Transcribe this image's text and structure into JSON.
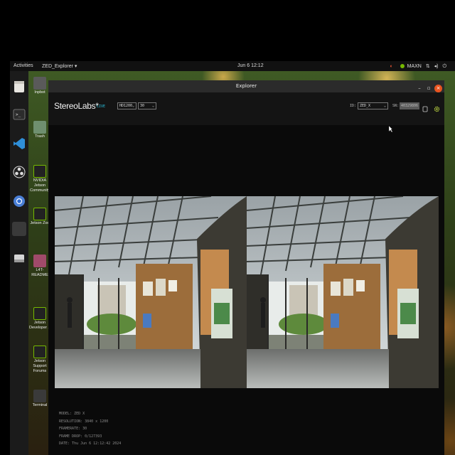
{
  "topbar": {
    "activities": "Activities",
    "app_menu": "ZED_Explorer ▾",
    "clock": "Jun 6 12:12",
    "power_mode": "MAXN",
    "tray_icons": [
      "nvidia-icon",
      "network-icon",
      "volume-icon",
      "power-icon"
    ]
  },
  "dock": {
    "items": [
      "files-icon",
      "terminal-icon",
      "vscode-icon",
      "obs-icon",
      "chromium-icon",
      "app-icon",
      "drive-icon"
    ]
  },
  "desktop": {
    "icons": [
      {
        "label": "Inpbot"
      },
      {
        "label": "Trash"
      },
      {
        "label": "NVIDIA Jetson Community"
      },
      {
        "label": "Jetson Zoo"
      },
      {
        "label": "L4T-README"
      },
      {
        "label": "Jetson Developer Z"
      },
      {
        "label": "Jetson Support Forums"
      },
      {
        "label": "Terminal"
      }
    ]
  },
  "window": {
    "title": "Explorer",
    "controls": [
      "–",
      "▫",
      "×"
    ]
  },
  "toolbar": {
    "logo": "StereoLabs*",
    "live_label": "LIVE",
    "resolution_select": "HD1200",
    "fps_select": "30",
    "id_label": "ID:",
    "id_select": "ZED_X",
    "sn_label": "SN:",
    "sn_value": "40329806"
  },
  "info": {
    "model": "MODEL: ZED X",
    "resolution": "RESOLUTION: 3840 x 1200",
    "framerate": "FRAMERATE: 30",
    "frame_drop": "FRAME DROP: 0/127393",
    "date": "DATE: Thu Jun 6 12:12:42 2024"
  },
  "colors": {
    "accent_live": "#29c3e0",
    "close_button": "#e95420",
    "nvidia_green": "#76b900"
  }
}
